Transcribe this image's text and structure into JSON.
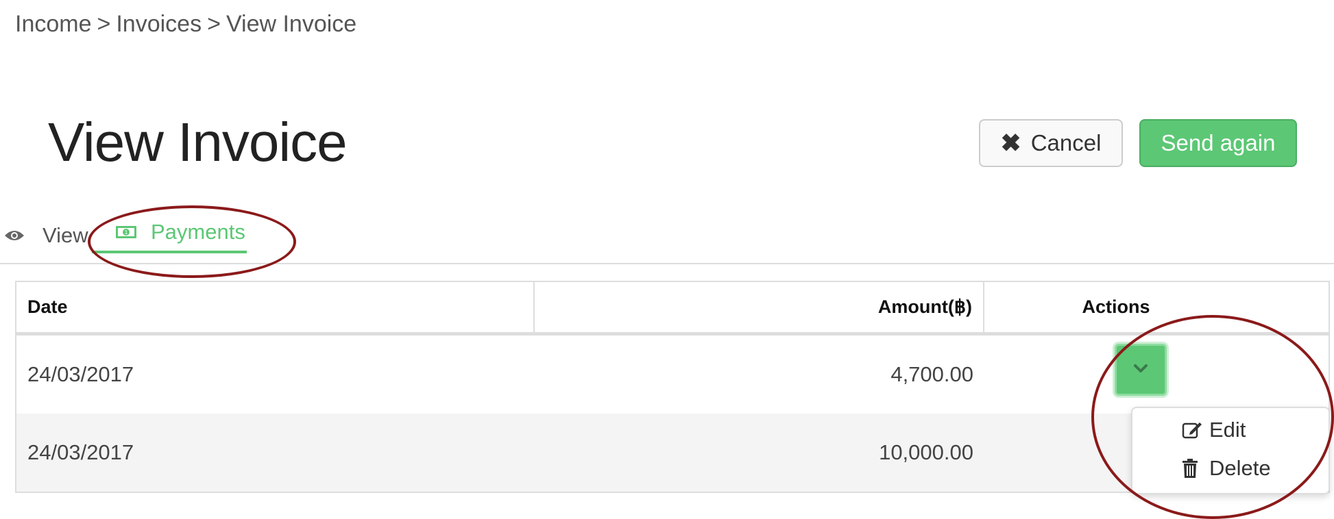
{
  "breadcrumb": {
    "items": [
      "Income",
      "Invoices",
      "View Invoice"
    ],
    "separator": ">"
  },
  "header": {
    "title": "View Invoice",
    "cancel_label": "Cancel",
    "send_label": "Send again"
  },
  "tabs": [
    {
      "label": "View",
      "icon": "eye-icon",
      "active": false
    },
    {
      "label": "Payments",
      "icon": "money-icon",
      "active": true
    }
  ],
  "table": {
    "columns": [
      "Date",
      "Amount(฿)",
      "Actions"
    ],
    "rows": [
      {
        "date": "24/03/2017",
        "amount": "4,700.00"
      },
      {
        "date": "24/03/2017",
        "amount": "10,000.00"
      }
    ]
  },
  "actions_menu": {
    "items": [
      {
        "label": "Edit",
        "icon": "edit-icon"
      },
      {
        "label": "Delete",
        "icon": "trash-icon"
      }
    ]
  },
  "colors": {
    "accent": "#5cc775",
    "annotation": "#8b1a1a"
  }
}
